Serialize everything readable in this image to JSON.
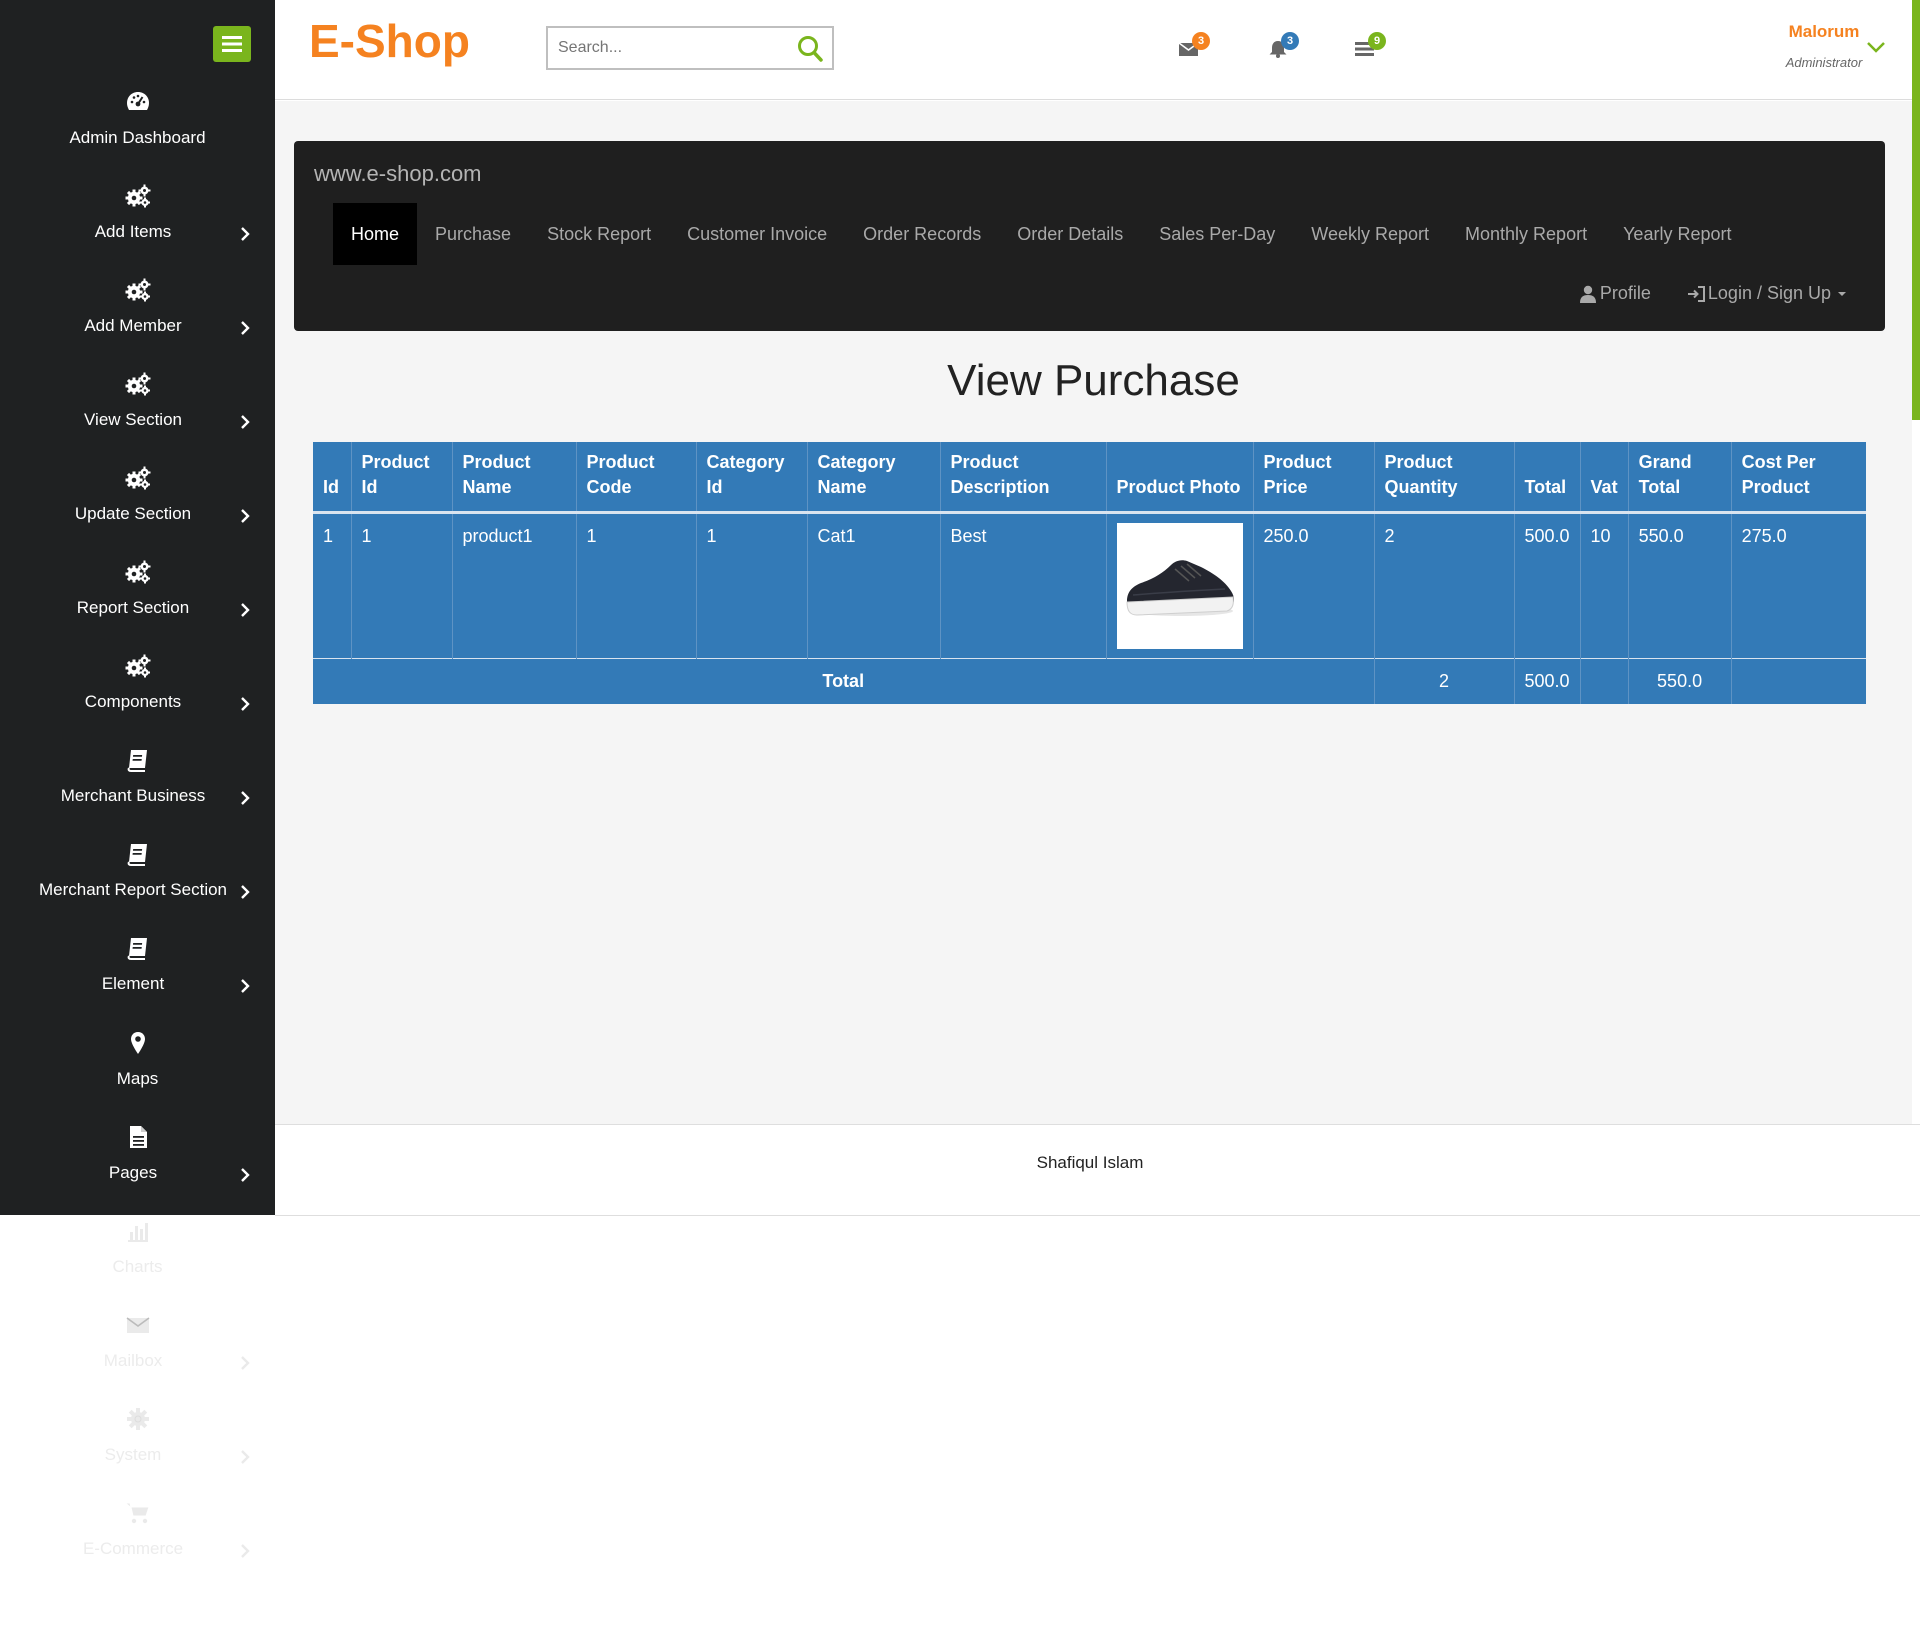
{
  "header": {
    "brand": "E-Shop",
    "search_placeholder": "Search...",
    "messages_count": "3",
    "notifications_count": "3",
    "tasks_count": "9",
    "user_name": "Malorum",
    "user_role": "Administrator"
  },
  "colors": {
    "accent_orange": "#f58220",
    "accent_green": "#7ab51d",
    "table_blue": "#337ab7",
    "sidebar_bg": "#1f2122"
  },
  "sidebar": {
    "items": [
      {
        "label": "Admin Dashboard",
        "icon": "dashboard-icon"
      },
      {
        "label": "Add Items",
        "icon": "gears-icon"
      },
      {
        "label": "Add Member",
        "icon": "gears-icon"
      },
      {
        "label": "View Section",
        "icon": "gears-icon"
      },
      {
        "label": "Update Section",
        "icon": "gears-icon"
      },
      {
        "label": "Report Section",
        "icon": "gears-icon"
      },
      {
        "label": "Components",
        "icon": "gears-icon"
      },
      {
        "label": "Merchant Business",
        "icon": "book-icon"
      },
      {
        "label": "Merchant Report Section",
        "icon": "book-icon"
      },
      {
        "label": "Element",
        "icon": "book-icon"
      },
      {
        "label": "Maps",
        "icon": "map-marker-icon"
      },
      {
        "label": "Pages",
        "icon": "file-icon"
      },
      {
        "label": "Charts",
        "icon": "bar-chart-icon"
      },
      {
        "label": "Mailbox",
        "icon": "envelope-icon"
      },
      {
        "label": "System",
        "icon": "gear-icon"
      },
      {
        "label": "E-Commerce",
        "icon": "cart-icon"
      }
    ]
  },
  "navbar": {
    "site": "www.e-shop.com",
    "tabs": [
      "Home",
      "Purchase",
      "Stock Report",
      "Customer Invoice",
      "Order Records",
      "Order Details",
      "Sales Per-Day",
      "Weekly Report",
      "Monthly Report",
      "Yearly Report"
    ],
    "profile": "Profile",
    "login": "Login / Sign Up"
  },
  "page": {
    "title": "View Purchase"
  },
  "table": {
    "headers": [
      "Id",
      "Product Id",
      "Product Name",
      "Product Code",
      "Category Id",
      "Category Name",
      "Product Description",
      "Product Photo",
      "Product Price",
      "Product Quantity",
      "Total",
      "Vat",
      "Grand Total",
      "Cost Per Product"
    ],
    "rows": [
      {
        "id": "1",
        "product_id": "1",
        "product_name": "product1",
        "product_code": "1",
        "category_id": "1",
        "category_name": "Cat1",
        "description": "Best",
        "price": "250.0",
        "quantity": "2",
        "total": "500.0",
        "vat": "10",
        "grand_total": "550.0",
        "cost_per_product": "275.0"
      }
    ],
    "footer": {
      "label": "Total",
      "quantity": "2",
      "total": "500.0",
      "grand_total": "550.0"
    }
  },
  "footer": {
    "text": "Shafiqul Islam"
  }
}
